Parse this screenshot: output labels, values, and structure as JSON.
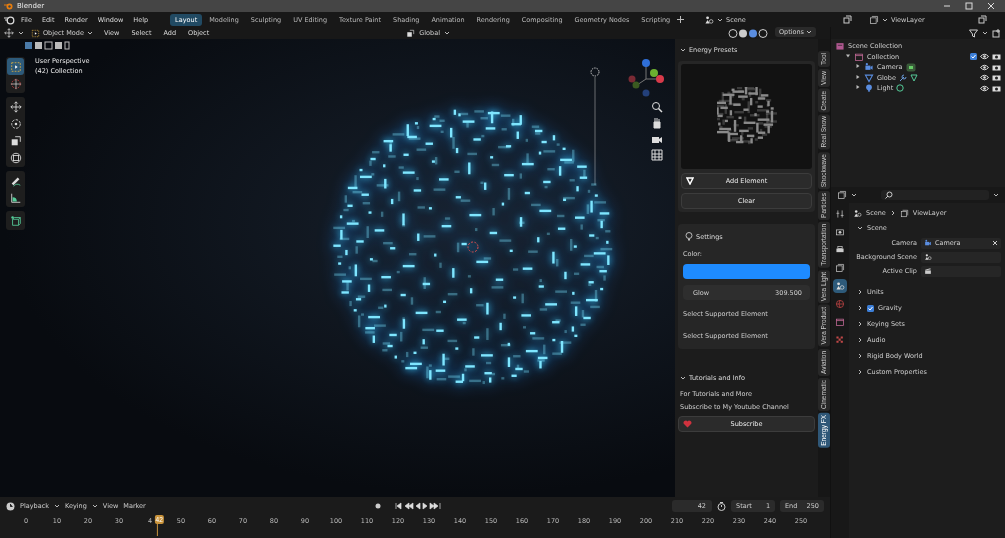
{
  "window": {
    "title": "Blender"
  },
  "menu": [
    "File",
    "Edit",
    "Render",
    "Window",
    "Help"
  ],
  "workspaces": [
    {
      "label": "Layout",
      "selected": true
    },
    {
      "label": "Modeling",
      "selected": false
    },
    {
      "label": "Sculpting",
      "selected": false
    },
    {
      "label": "UV Editing",
      "selected": false
    },
    {
      "label": "Texture Paint",
      "selected": false
    },
    {
      "label": "Shading",
      "selected": false
    },
    {
      "label": "Animation",
      "selected": false
    },
    {
      "label": "Rendering",
      "selected": false
    },
    {
      "label": "Compositing",
      "selected": false
    },
    {
      "label": "Geometry Nodes",
      "selected": false
    },
    {
      "label": "Scripting",
      "selected": false
    }
  ],
  "scene_selector": {
    "scene": "Scene",
    "view_layer": "ViewLayer"
  },
  "viewport_header": {
    "mode": "Object Mode",
    "menus": [
      "View",
      "Select",
      "Add",
      "Object"
    ],
    "orientation": "Global",
    "options": "Options"
  },
  "viewport": {
    "info": [
      "User Perspective",
      "(42) Collection"
    ]
  },
  "tools": [
    {
      "kind": "select",
      "selected": true
    },
    {
      "kind": "cursor",
      "selected": false
    },
    {
      "kind": "move",
      "selected": false
    },
    {
      "kind": "rotate",
      "selected": false
    },
    {
      "kind": "scale",
      "selected": false
    },
    {
      "kind": "transform",
      "selected": false
    },
    {
      "kind": "annotate",
      "selected": false
    },
    {
      "kind": "measure",
      "selected": false
    },
    {
      "kind": "add-cube",
      "selected": false
    }
  ],
  "sidebar": {
    "presets": {
      "title": "Energy Presets",
      "buttons": [
        "Add Element",
        "Clear"
      ]
    },
    "settings": {
      "title": "Settings",
      "color_label": "Color:",
      "color": "#1e8bff",
      "glow_label": "Glow",
      "glow_value": "309.500",
      "notes": [
        "Select Supported Element",
        "Select Supported Element"
      ]
    },
    "tutorials": {
      "title": "Tutorials and Info",
      "lines": [
        "For Tutorials and More",
        "Subscribe to My Youtube Channel"
      ],
      "button": "Subscribe"
    }
  },
  "side_tabs": [
    {
      "label": "Tool",
      "selected": false
    },
    {
      "label": "View",
      "selected": false
    },
    {
      "label": "Create",
      "selected": false
    },
    {
      "label": "Real Snow",
      "selected": false
    },
    {
      "label": "Shockwave",
      "selected": false
    },
    {
      "label": "Particles",
      "selected": false
    },
    {
      "label": "Transportation",
      "selected": false
    },
    {
      "label": "Vera Light",
      "selected": false
    },
    {
      "label": "Vera Product",
      "selected": false
    },
    {
      "label": "Aviation",
      "selected": false
    },
    {
      "label": "Cinematic",
      "selected": false
    },
    {
      "label": "Energy FX",
      "selected": true
    }
  ],
  "outliner": {
    "tree": [
      {
        "label": "Scene Collection",
        "kind": "scene-collection",
        "children": [
          {
            "label": "Collection",
            "kind": "collection",
            "expanded": true,
            "checked": true,
            "children": [
              {
                "label": "Camera",
                "kind": "camera",
                "expanded": false
              },
              {
                "label": "Globe",
                "kind": "mesh",
                "expanded": false
              },
              {
                "label": "Light",
                "kind": "light",
                "expanded": false
              }
            ]
          }
        ]
      }
    ]
  },
  "properties": {
    "tabs": [
      {
        "kind": "tool",
        "selected": false
      },
      {
        "kind": "render",
        "selected": false
      },
      {
        "kind": "output",
        "selected": false
      },
      {
        "kind": "view-layer",
        "selected": false
      },
      {
        "kind": "scene",
        "selected": true
      },
      {
        "kind": "world",
        "selected": false
      },
      {
        "kind": "collection",
        "selected": false
      },
      {
        "kind": "texture",
        "selected": false
      }
    ],
    "breadcrumb": [
      "Scene",
      "ViewLayer"
    ],
    "section": "Scene",
    "fields": [
      {
        "label": "Camera",
        "kind": "camera",
        "value": "Camera"
      },
      {
        "label": "Background Scene",
        "kind": "scene"
      },
      {
        "label": "Active Clip",
        "kind": "clip"
      }
    ],
    "subpanels": [
      {
        "label": "Units",
        "kind": "plain"
      },
      {
        "label": "Gravity",
        "kind": "checkbox",
        "checked": true
      },
      {
        "label": "Keying Sets",
        "kind": "plain"
      },
      {
        "label": "Audio",
        "kind": "plain"
      },
      {
        "label": "Rigid Body World",
        "kind": "plain"
      },
      {
        "label": "Custom Properties",
        "kind": "plain"
      }
    ]
  },
  "timeline": {
    "menus": [
      "Playback",
      "Keying",
      "View",
      "Marker"
    ],
    "current_frame": "42",
    "start_label": "Start",
    "start": "1",
    "end_label": "End",
    "end": "250",
    "playhead": "42",
    "ticks": [
      "0",
      "10",
      "20",
      "30",
      "4",
      "50",
      "60",
      "70",
      "80",
      "90",
      "100",
      "110",
      "120",
      "130",
      "140",
      "150",
      "160",
      "170",
      "180",
      "190",
      "200",
      "210",
      "220",
      "230",
      "240",
      "250"
    ]
  }
}
